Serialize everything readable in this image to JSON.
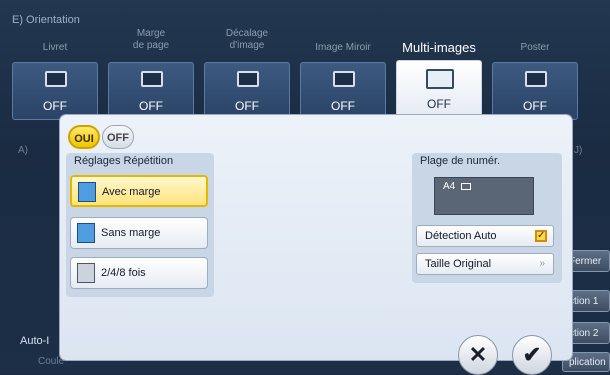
{
  "header": {
    "section_label": "E) Orientation"
  },
  "tabs": [
    {
      "label": "Livret",
      "value": "OFF",
      "icon": "booklet-icon"
    },
    {
      "label": "Marge\nde page",
      "value": "OFF",
      "icon": "page-margin-icon"
    },
    {
      "label": "Décalage\nd'image",
      "value": "OFF",
      "icon": "image-shift-icon"
    },
    {
      "label": "Image Miroir",
      "value": "OFF",
      "icon": "mirror-image-icon"
    },
    {
      "label": "Multi-images",
      "value": "OFF",
      "icon": "multi-image-icon",
      "active": true
    },
    {
      "label": "Poster",
      "value": "OFF",
      "icon": "poster-icon"
    }
  ],
  "background": {
    "row_a_label": "A)",
    "row_j_label": "J)",
    "right_buttons": [
      "Fermer",
      "ction 1",
      "ction 2",
      "plication"
    ],
    "left_button": "Auto-I",
    "bottom_labels": [
      "Coule",
      "Original"
    ]
  },
  "dialog": {
    "toggle_on": "OUI",
    "toggle_off": "OFF",
    "repeat_group": {
      "title": "Réglages Répétition",
      "options": [
        {
          "label": "Avec marge",
          "selected": true
        },
        {
          "label": "Sans marge",
          "selected": false
        },
        {
          "label": "2/4/8 fois",
          "selected": false
        }
      ]
    },
    "numbering_group": {
      "title": "Plage de numér.",
      "paper_size": "A4",
      "auto_detect_label": "Détection Auto",
      "auto_detect_checked": true,
      "original_size_label": "Taille Original"
    },
    "cancel_symbol": "✕",
    "ok_symbol": "✔"
  }
}
